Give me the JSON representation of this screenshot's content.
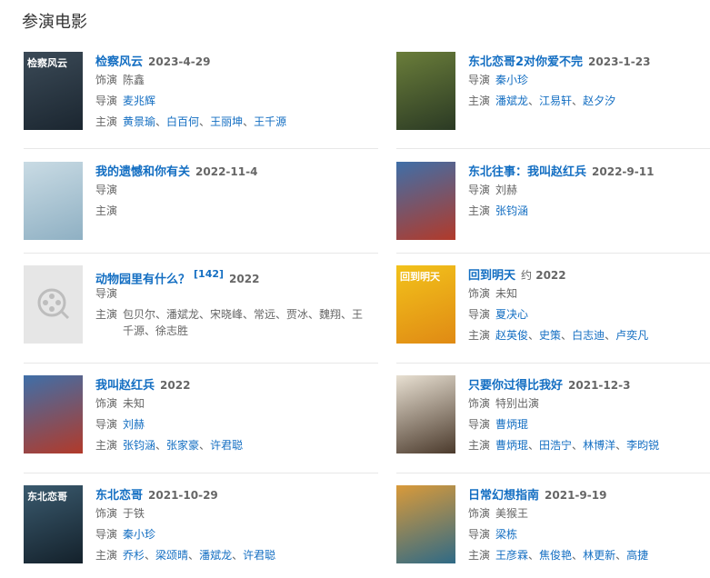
{
  "section": {
    "title": "参演电影"
  },
  "films": [
    {
      "title": "检察风云",
      "date": "2023-4-29",
      "date_prefix": "",
      "ref": "",
      "poster_text": "检察风云",
      "poster_colors": [
        "#3b4a57",
        "#1b2630"
      ],
      "role_label": "饰演",
      "role": "陈鑫",
      "role_link": false,
      "director_label": "导演",
      "directors": [
        "麦兆辉"
      ],
      "cast_label": "主演",
      "cast": [
        "黄景瑜",
        "白百何",
        "王丽坤",
        "王千源"
      ]
    },
    {
      "title": "东北恋哥2对你爱不完",
      "date": "2023-1-23",
      "date_prefix": "",
      "ref": "",
      "poster_text": "",
      "poster_colors": [
        "#6a7d3a",
        "#2b3a24"
      ],
      "role_label": "导演",
      "role": "秦小珍",
      "role_link": true,
      "director_label": "主演",
      "directors": [
        "潘斌龙",
        "江易轩",
        "赵夕汐"
      ],
      "cast_label": "",
      "cast": []
    },
    {
      "title": "我的遗憾和你有关",
      "date": "2022-11-4",
      "date_prefix": "",
      "ref": "",
      "poster_text": "",
      "poster_colors": [
        "#c9dbe4",
        "#8fb0c3"
      ],
      "role_label": "导演",
      "role": "",
      "role_link": false,
      "director_label": "主演",
      "directors": [],
      "cast_label": "",
      "cast": []
    },
    {
      "title": "东北往事：我叫赵红兵",
      "date": "2022-9-11",
      "date_prefix": "",
      "ref": "",
      "poster_text": "",
      "poster_colors": [
        "#3f6fa8",
        "#b23a2a"
      ],
      "role_label": "导演",
      "role": "刘赫",
      "role_link": false,
      "director_label": "主演",
      "directors": [
        "张钧涵"
      ],
      "cast_label": "",
      "cast": []
    },
    {
      "title": "动物园里有什么？",
      "date": "2022",
      "date_prefix": "",
      "ref": "[142]",
      "poster_text": "",
      "poster_colors": [
        "#e6e6e6",
        "#e6e6e6"
      ],
      "role_label": "导演",
      "role": "",
      "role_link": false,
      "director_label": "主演",
      "directors": [],
      "cast_label": "",
      "cast": [],
      "cast_plain": "包贝尔、潘斌龙、宋晓峰、常远、贾冰、魏翔、王千源、徐志胜"
    },
    {
      "title": "回到明天",
      "date": "2022",
      "date_prefix": "约",
      "ref": "",
      "poster_text": "回到明天",
      "poster_colors": [
        "#f2c21b",
        "#e08a14"
      ],
      "role_label": "饰演",
      "role": "未知",
      "role_link": false,
      "director_label": "导演",
      "directors": [
        "夏决心"
      ],
      "cast_label": "主演",
      "cast": [
        "赵英俊",
        "史策",
        "白志迪",
        "卢奕凡"
      ]
    },
    {
      "title": "我叫赵红兵",
      "date": "2022",
      "date_prefix": "",
      "ref": "",
      "poster_text": "",
      "poster_colors": [
        "#3f6fa8",
        "#b23a2a"
      ],
      "role_label": "饰演",
      "role": "未知",
      "role_link": false,
      "director_label": "导演",
      "directors": [
        "刘赫"
      ],
      "cast_label": "主演",
      "cast": [
        "张钧涵",
        "张家豪",
        "许君聪"
      ]
    },
    {
      "title": "只要你过得比我好",
      "date": "2021-12-3",
      "date_prefix": "",
      "ref": "",
      "poster_text": "",
      "poster_colors": [
        "#e8e0d2",
        "#4b3a2c"
      ],
      "role_label": "饰演",
      "role": "特别出演",
      "role_link": false,
      "director_label": "导演",
      "directors": [
        "曹炳琨"
      ],
      "cast_label": "主演",
      "cast": [
        "曹炳琨",
        "田浩宁",
        "林博洋",
        "李昀锐"
      ]
    },
    {
      "title": "东北恋哥",
      "date": "2021-10-29",
      "date_prefix": "",
      "ref": "",
      "poster_text": "东北恋哥",
      "poster_colors": [
        "#3a5a6e",
        "#14212b"
      ],
      "role_label": "饰演",
      "role": "于铁",
      "role_link": false,
      "director_label": "导演",
      "directors": [
        "秦小珍"
      ],
      "cast_label": "主演",
      "cast": [
        "乔杉",
        "梁颂晴",
        "潘斌龙",
        "许君聪"
      ]
    },
    {
      "title": "日常幻想指南",
      "date": "2021-9-19",
      "date_prefix": "",
      "ref": "",
      "poster_text": "",
      "poster_colors": [
        "#d99a3a",
        "#2f6a86"
      ],
      "role_label": "饰演",
      "role": "美猴王",
      "role_link": false,
      "director_label": "导演",
      "directors": [
        "梁栋"
      ],
      "cast_label": "主演",
      "cast": [
        "王彦霖",
        "焦俊艳",
        "林更新",
        "高捷"
      ]
    }
  ]
}
